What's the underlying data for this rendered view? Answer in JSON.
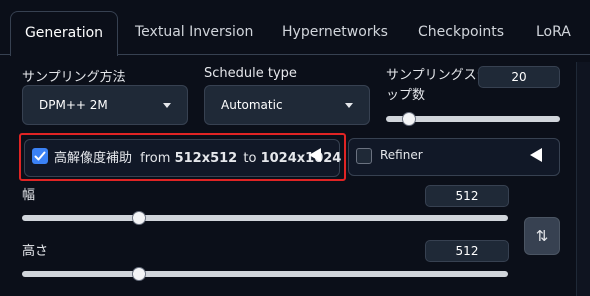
{
  "tabs": [
    {
      "label": "Generation"
    },
    {
      "label": "Textual Inversion"
    },
    {
      "label": "Hypernetworks"
    },
    {
      "label": "Checkpoints"
    },
    {
      "label": "LoRA"
    }
  ],
  "sampling_method": {
    "label": "サンプリング方法",
    "value": "DPM++ 2M"
  },
  "schedule_type": {
    "label": "Schedule type",
    "value": "Automatic"
  },
  "sampling_steps": {
    "label_line1": "サンプリングステ",
    "label_line2": "ップ数",
    "value": "20",
    "slider_fraction": 0.13
  },
  "hires_fix": {
    "label": "高解像度補助",
    "from_text": "from",
    "from_res": "512x512",
    "to_text": "to",
    "to_res": "1024x1024",
    "checked": true
  },
  "refiner": {
    "label": "Refiner",
    "checked": false
  },
  "width": {
    "label": "幅",
    "value": "512",
    "slider_fraction": 0.24
  },
  "height": {
    "label": "高さ",
    "value": "512",
    "slider_fraction": 0.24
  },
  "swap_button": {
    "label": "⇅"
  },
  "colors": {
    "accent": "#3b82f6",
    "highlight": "#e02424",
    "background": "#0b0f19"
  }
}
